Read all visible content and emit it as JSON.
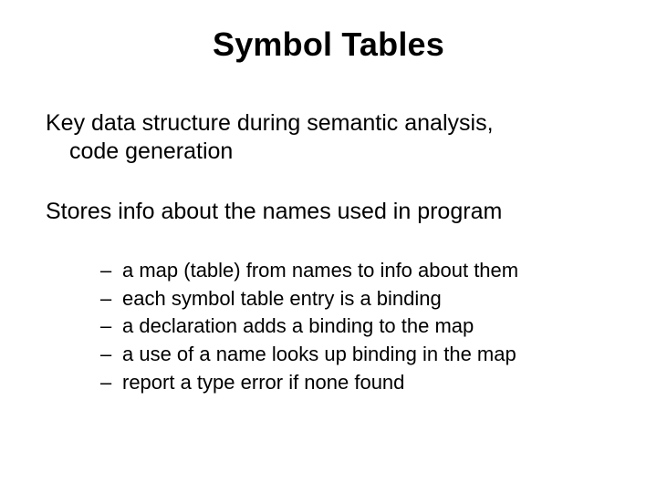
{
  "title": "Symbol Tables",
  "para1_line1": "Key data structure during semantic analysis,",
  "para1_line2": "code generation",
  "para2": "Stores info about the names used in program",
  "bullets": {
    "dash": "–",
    "b0": "a map (table) from names to info about them",
    "b1": "each symbol table entry is a binding",
    "b2": "a declaration adds a binding to the map",
    "b3": "a use of a name looks up binding in the map",
    "b4": "report a type error if none found"
  }
}
